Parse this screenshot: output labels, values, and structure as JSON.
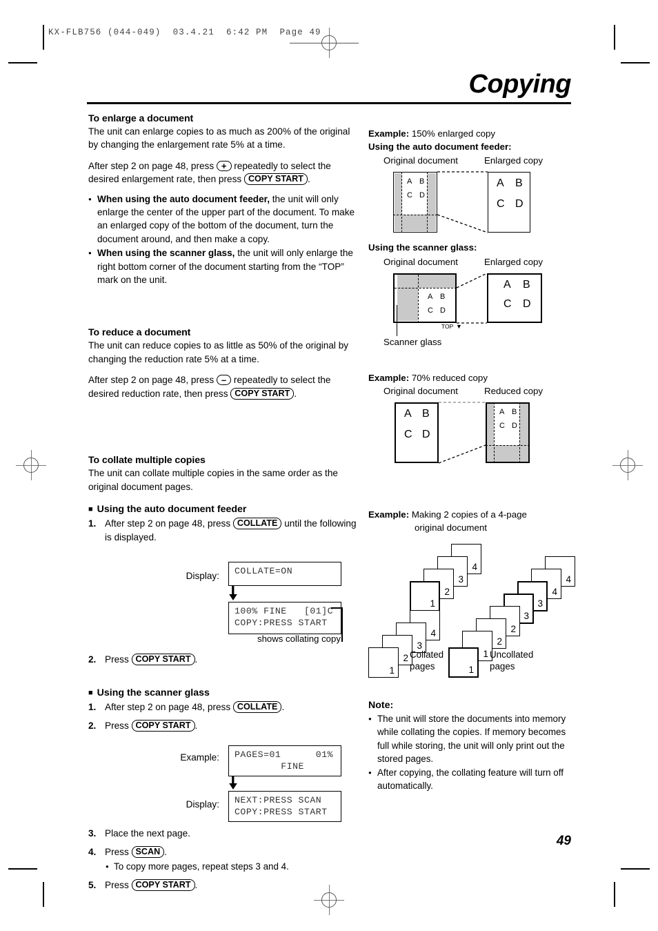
{
  "print_bar": "KX-FLB756 (044-049)  03.4.21  6:42 PM  Page 49",
  "chapter_title": "Copying",
  "page_number": "49",
  "left_column": {
    "enlarge": {
      "heading": "To enlarge a document",
      "intro": "The unit can enlarge copies to as much as 200% of the original by changing the enlargement rate 5% at a time.",
      "instruction_pre": "After step 2 on page 48, press",
      "key_plus": "+",
      "instruction_mid": "repeatedly to select the desired enlargement rate, then press",
      "key_copy_start": "COPY START",
      "instruction_end": ".",
      "bullets": [
        {
          "bold": "When using the auto document feeder,",
          "rest": " the unit will only enlarge the center of the upper part of the document. To make an enlarged copy of the bottom of the document, turn the document around, and then make a copy."
        },
        {
          "bold": "When using the scanner glass,",
          "rest": " the unit will only enlarge the right bottom corner of the document starting from the “TOP” mark on the unit."
        }
      ]
    },
    "reduce": {
      "heading": "To reduce a document",
      "intro": "The unit can reduce copies to as little as 50% of the original by changing the reduction rate 5% at a time.",
      "instruction_pre": "After step 2 on page 48, press",
      "key_minus": "–",
      "instruction_mid": "repeatedly to select the desired reduction rate, then press",
      "key_copy_start": "COPY START",
      "instruction_end": "."
    },
    "collate": {
      "heading": "To collate multiple copies",
      "intro": "The unit can collate multiple copies in the same order as the original document pages.",
      "adf": {
        "heading": "Using the auto document feeder",
        "step1_num": "1.",
        "step1_pre": "After step 2 on page 48, press",
        "step1_key": "COLLATE",
        "step1_post": "until the following is displayed.",
        "display_label": "Display:",
        "lcd1": "COLLATE=ON",
        "lcd2_line1": "100% FINE   [01]C",
        "lcd2_line2": "COPY:PRESS START",
        "callout": "shows collating copy",
        "step2_num": "2.",
        "step2_pre": "Press",
        "step2_key": "COPY START",
        "step2_post": "."
      },
      "glass": {
        "heading": "Using the scanner glass",
        "step1_num": "1.",
        "step1_pre": "After step 2 on page 48, press",
        "step1_key": "COLLATE",
        "step1_post": ".",
        "step2_num": "2.",
        "step2_pre": "Press",
        "step2_key": "COPY START",
        "step2_post": ".",
        "example_label": "Example:",
        "lcd1_line1": "PAGES=01      01%",
        "lcd1_line2": "        FINE",
        "display_label": "Display:",
        "lcd2_line1": "NEXT:PRESS SCAN",
        "lcd2_line2": "COPY:PRESS START",
        "step3_num": "3.",
        "step3_text": "Place the next page.",
        "step4_num": "4.",
        "step4_pre": "Press",
        "step4_key": "SCAN",
        "step4_post": ".",
        "step4_sub": "To copy more pages, repeat steps 3 and 4.",
        "step5_num": "5.",
        "step5_pre": "Press",
        "step5_key": "COPY START",
        "step5_post": "."
      }
    }
  },
  "right_column": {
    "enlarge_example": {
      "label": "Example:",
      "text": "150% enlarged copy",
      "adf_heading": "Using the auto document feeder:",
      "cap_original": "Original document",
      "cap_copy": "Enlarged copy",
      "letters": [
        "A",
        "B",
        "C",
        "D"
      ]
    },
    "glass_example": {
      "heading": "Using the scanner glass:",
      "cap_original": "Original document",
      "cap_copy": "Enlarged copy",
      "top_mark": "TOP",
      "scanner_glass_label": "Scanner glass",
      "letters": [
        "A",
        "B",
        "C",
        "D"
      ]
    },
    "reduce_example": {
      "label": "Example:",
      "text": "70% reduced copy",
      "cap_original": "Original document",
      "cap_copy": "Reduced copy",
      "letters": [
        "A",
        "B",
        "C",
        "D"
      ]
    },
    "collate_example": {
      "label": "Example:",
      "text_line1": "Making 2 copies of a 4-page",
      "text_line2": "original document",
      "collated_label_line1": "Collated",
      "collated_label_line2": "pages",
      "uncollated_label_line1": "Uncollated",
      "uncollated_label_line2": "pages",
      "collated_stack_top": [
        "1",
        "2",
        "3",
        "4"
      ],
      "collated_stack_bottom": [
        "1",
        "2",
        "3",
        "4"
      ],
      "uncollated_stack_top": [
        "3",
        "4",
        "4"
      ],
      "uncollated_stack_bottom": [
        "1",
        "1",
        "2",
        "2",
        "3"
      ]
    },
    "note": {
      "heading": "Note:",
      "items": [
        "The unit will store the documents into memory while collating the copies. If memory becomes full while storing, the unit will only print out the stored pages.",
        "After copying, the collating feature will turn off automatically."
      ]
    }
  }
}
